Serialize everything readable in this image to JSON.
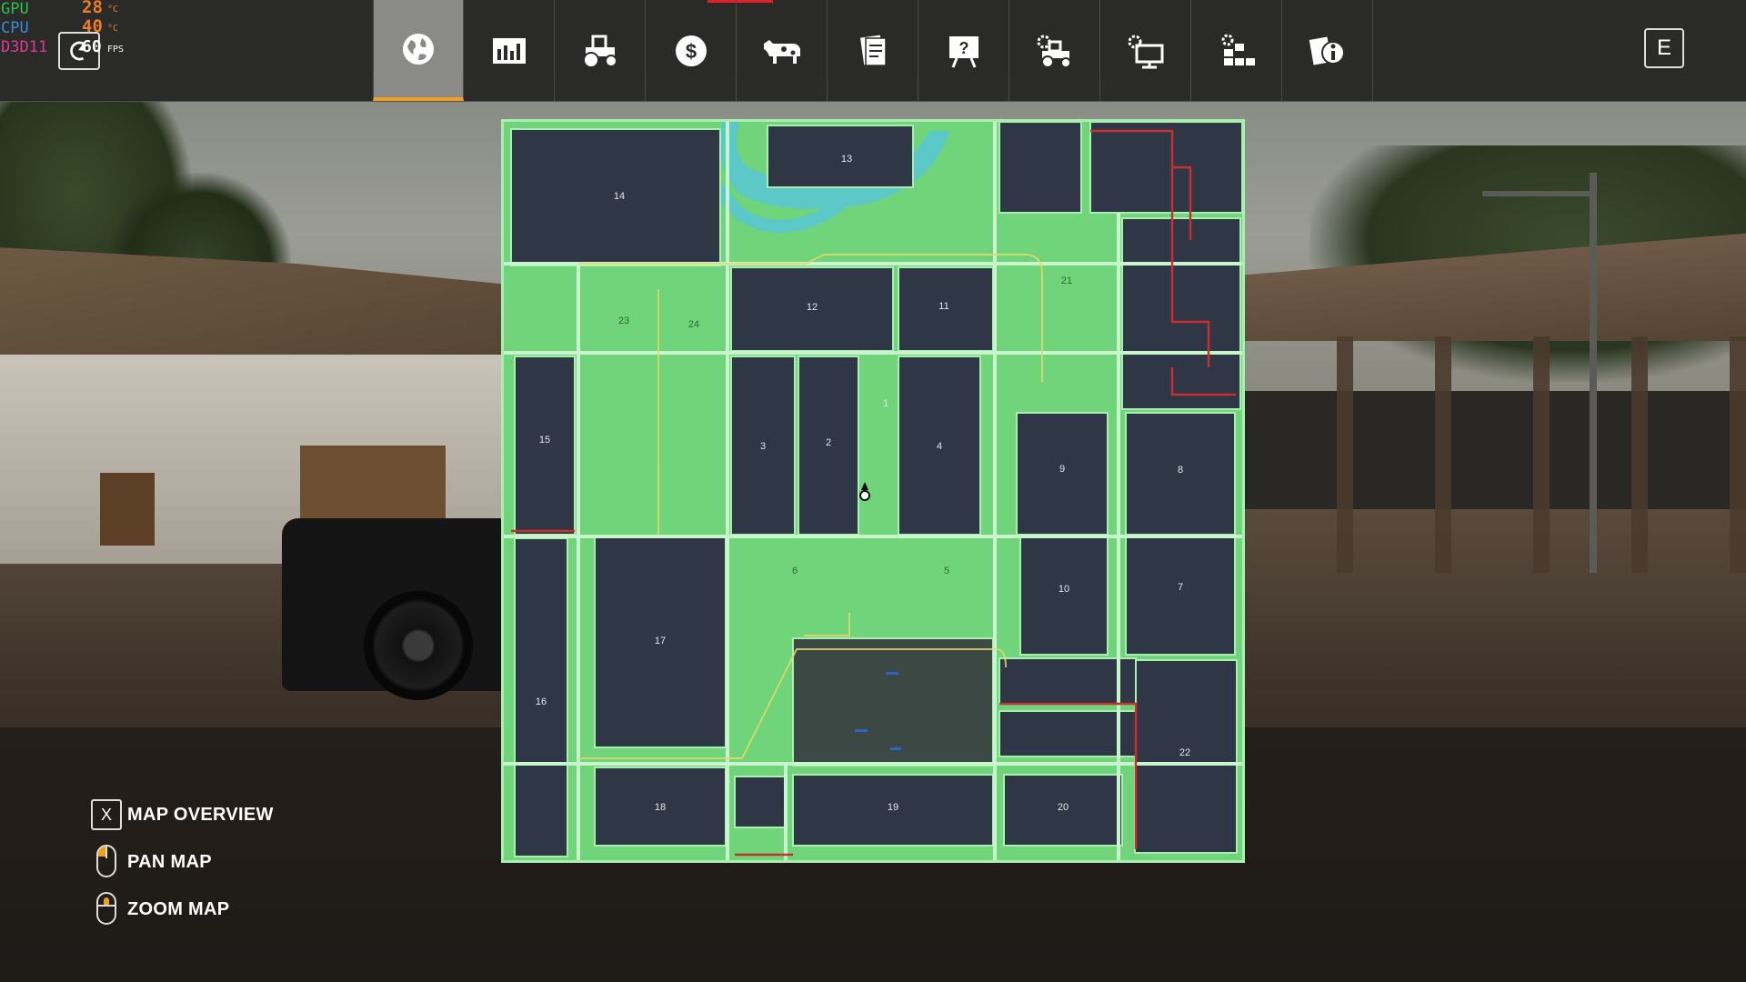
{
  "perf": {
    "gpu_label": "GPU",
    "gpu_value": "28",
    "gpu_unit": "°C",
    "cpu_label": "CPU",
    "cpu_value": "40",
    "cpu_unit": "°C",
    "api_label": "D3D11",
    "fps_value": "60",
    "fps_unit": "FPS"
  },
  "nav": {
    "tabs": [
      {
        "icon": "globe-icon",
        "active": true
      },
      {
        "icon": "statistics-icon",
        "active": false
      },
      {
        "icon": "tractor-icon",
        "active": false
      },
      {
        "icon": "dollar-icon",
        "active": false
      },
      {
        "icon": "cow-icon",
        "active": false
      },
      {
        "icon": "contracts-icon",
        "active": false
      },
      {
        "icon": "help-board-icon",
        "active": false
      },
      {
        "icon": "vehicle-settings-icon",
        "active": false
      },
      {
        "icon": "display-settings-icon",
        "active": false
      },
      {
        "icon": "production-icon",
        "active": false
      },
      {
        "icon": "info-icon",
        "active": false
      }
    ],
    "close_key": "E"
  },
  "map": {
    "fields": [
      {
        "id": "field-1",
        "label": "1"
      },
      {
        "id": "field-2",
        "label": "2"
      },
      {
        "id": "field-3",
        "label": "3"
      },
      {
        "id": "field-4",
        "label": "4"
      },
      {
        "id": "field-5",
        "label": "5"
      },
      {
        "id": "field-6",
        "label": "6"
      },
      {
        "id": "field-7",
        "label": "7"
      },
      {
        "id": "field-8",
        "label": "8"
      },
      {
        "id": "field-9",
        "label": "9"
      },
      {
        "id": "field-10",
        "label": "10"
      },
      {
        "id": "field-11",
        "label": "11"
      },
      {
        "id": "field-12",
        "label": "12"
      },
      {
        "id": "field-13",
        "label": "13"
      },
      {
        "id": "field-14",
        "label": "14"
      },
      {
        "id": "field-15",
        "label": "15"
      },
      {
        "id": "field-16",
        "label": "16"
      },
      {
        "id": "field-17",
        "label": "17"
      },
      {
        "id": "field-18",
        "label": "18"
      },
      {
        "id": "field-19",
        "label": "19"
      },
      {
        "id": "field-20",
        "label": "20"
      },
      {
        "id": "field-21",
        "label": "21"
      },
      {
        "id": "field-22",
        "label": "22"
      },
      {
        "id": "field-23",
        "label": "23"
      },
      {
        "id": "field-24",
        "label": "24"
      }
    ]
  },
  "legend": {
    "overview_key": "X",
    "overview_label": "MAP OVERVIEW",
    "pan_label": "PAN MAP",
    "zoom_label": "ZOOM MAP"
  },
  "colors": {
    "accent": "#f0a020",
    "map_green": "#6fd47a",
    "field_dark": "#2f3646",
    "water": "#5cc8c8",
    "gpu_text": "#2fc24a",
    "cpu_text": "#3a8ad8",
    "temp_text": "#f07a20",
    "boundary_red": "#c83030"
  }
}
